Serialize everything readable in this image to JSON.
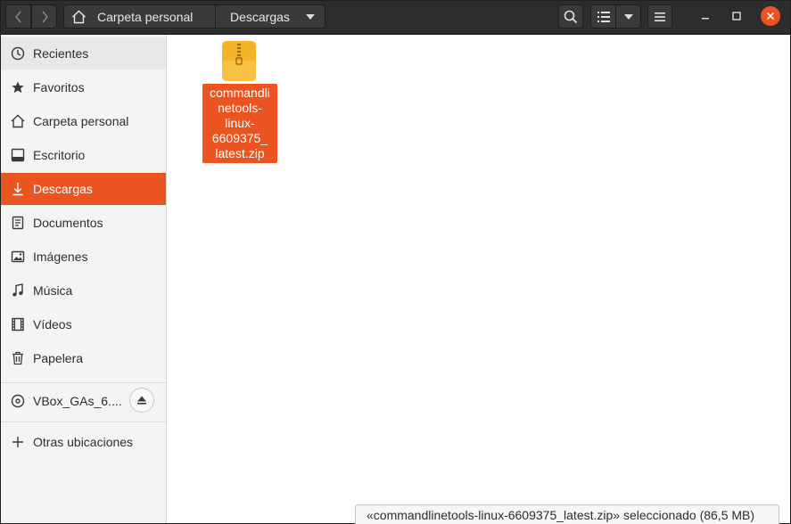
{
  "headerbar": {
    "path": {
      "home": "Carpeta personal",
      "current": "Descargas"
    }
  },
  "sidebar": {
    "items": [
      {
        "label": "Recientes",
        "icon": "clock-icon"
      },
      {
        "label": "Favoritos",
        "icon": "star-icon"
      },
      {
        "label": "Carpeta personal",
        "icon": "home-icon"
      },
      {
        "label": "Escritorio",
        "icon": "desktop-icon"
      },
      {
        "label": "Descargas",
        "icon": "download-icon"
      },
      {
        "label": "Documentos",
        "icon": "document-icon"
      },
      {
        "label": "Imágenes",
        "icon": "image-icon"
      },
      {
        "label": "Música",
        "icon": "music-icon"
      },
      {
        "label": "Vídeos",
        "icon": "video-icon"
      },
      {
        "label": "Papelera",
        "icon": "trash-icon"
      }
    ],
    "device": {
      "label": "VBox_GAs_6....",
      "icon": "disc-icon"
    },
    "other": {
      "label": "Otras ubicaciones",
      "icon": "plus-icon"
    }
  },
  "content": {
    "files": [
      {
        "name": "commandlinetools-linux-6609375_latest.zip",
        "lines": [
          "commandli",
          "netools-",
          "linux-",
          "6609375_",
          "latest.zip"
        ],
        "icon": "zip-archive-icon"
      }
    ]
  },
  "status": {
    "text": "«commandlinetools-linux-6609375_latest.zip» seleccionado  (86,5 MB)"
  },
  "colors": {
    "accent": "#e95420",
    "headerbar": "#2d2d2d",
    "sidebar": "#f4f4f4"
  }
}
